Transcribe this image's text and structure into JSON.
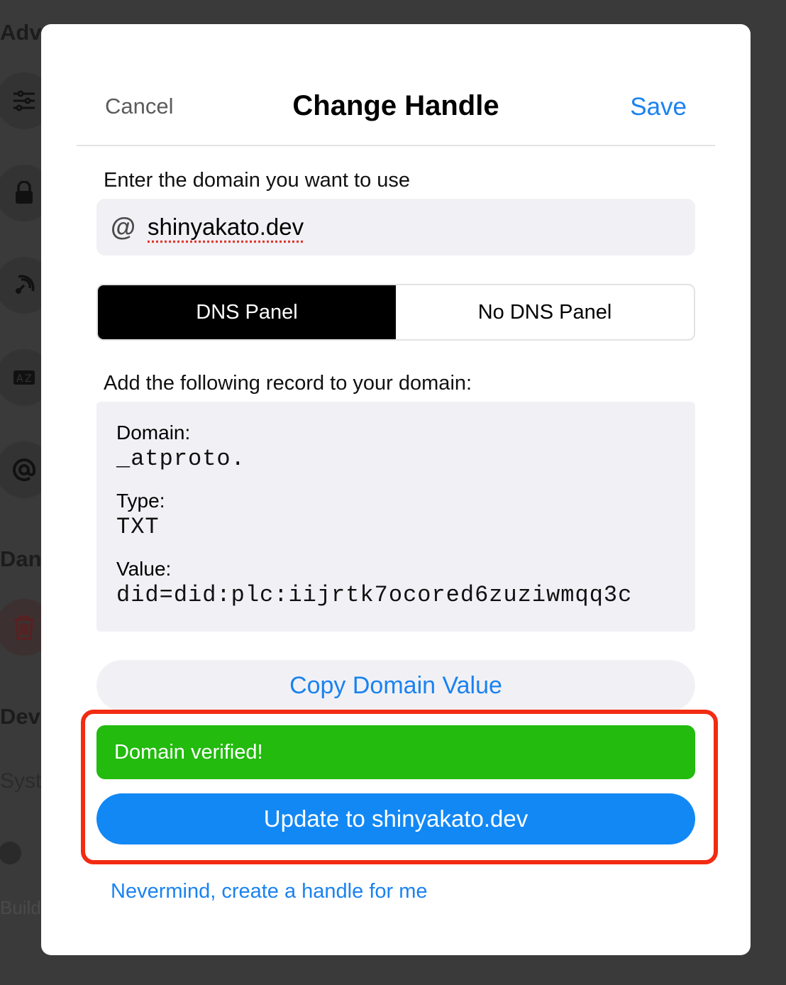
{
  "background": {
    "headings": [
      "Adv",
      "Dan",
      "Dev"
    ],
    "system_text": "Syst",
    "build_text": "Build"
  },
  "modal": {
    "cancel_label": "Cancel",
    "title": "Change Handle",
    "save_label": "Save",
    "domain_prompt": "Enter the domain you want to use",
    "domain_input": {
      "at_symbol": "@",
      "value": "shinyakato.dev"
    },
    "segments": {
      "dns_panel": "DNS Panel",
      "no_dns_panel": "No DNS Panel",
      "selected": "DNS Panel"
    },
    "record_instruction": "Add the following record to your domain:",
    "record": {
      "domain_label": "Domain:",
      "domain_value": "_atproto.",
      "type_label": "Type:",
      "type_value": "TXT",
      "value_label": "Value:",
      "value_value": "did=did:plc:iijrtk7ocored6zuziwmqq3c"
    },
    "copy_button": "Copy Domain Value",
    "verified_message": "Domain verified!",
    "update_button": "Update to shinyakato.dev",
    "nevermind_link": "Nevermind, create a handle for me"
  },
  "colors": {
    "accent": "#1a82f0",
    "success": "#22bb0e",
    "highlight": "#f22b12",
    "primary_button": "#1288f5"
  }
}
